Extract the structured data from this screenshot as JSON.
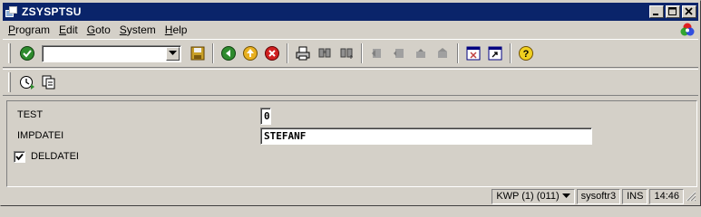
{
  "window": {
    "title": "ZSYSPTSU",
    "controls": [
      "minimize-icon",
      "maximize-icon",
      "close-icon"
    ]
  },
  "menu": {
    "items": [
      "Program",
      "Edit",
      "Goto",
      "System",
      "Help"
    ]
  },
  "toolbar": {
    "command_field": {
      "value": "",
      "placeholder": ""
    },
    "icons": [
      "enter-check-icon",
      "save-icon",
      "back-icon",
      "exit-icon",
      "cancel-icon",
      "print-icon",
      "find-icon",
      "find-next-icon",
      "first-page-icon",
      "previous-page-icon",
      "next-page-icon",
      "last-page-icon",
      "create-session-icon",
      "create-shortcut-icon",
      "help-icon"
    ]
  },
  "application_toolbar": {
    "icons": [
      "execute-icon",
      "get-variant-icon"
    ]
  },
  "form": {
    "test": {
      "label": "TEST",
      "value": "0"
    },
    "impdatei": {
      "label": "IMPDATEI",
      "value": "STEFANF"
    },
    "deldatei": {
      "label": "DELDATEI",
      "checked": true
    }
  },
  "status": {
    "system": "KWP (1) (011)",
    "server": "sysoftr3",
    "mode": "INS",
    "time": "14:46"
  }
}
